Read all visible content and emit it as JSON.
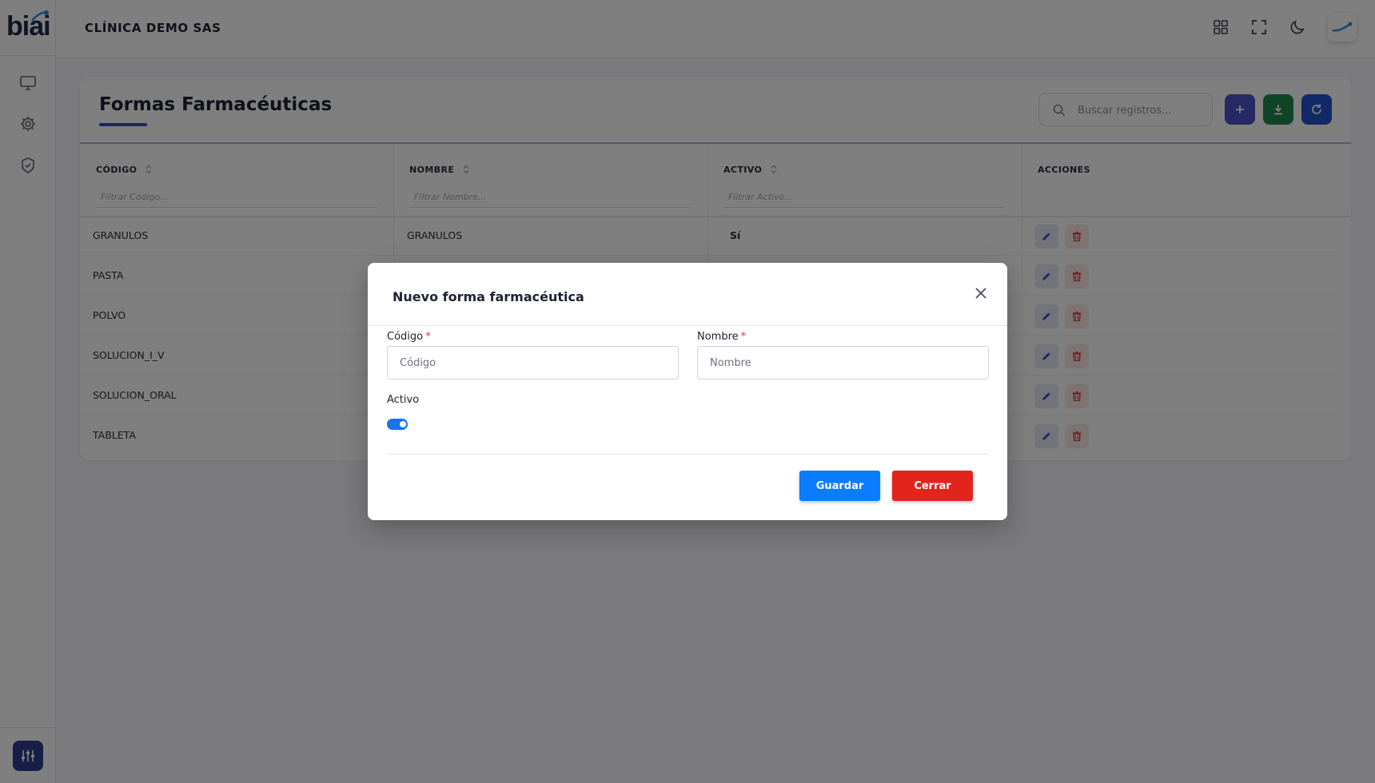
{
  "app": {
    "logo_text": "biai"
  },
  "topbar": {
    "company": "CLÍNICA DEMO SAS",
    "icons": [
      "apps-grid-icon",
      "fullscreen-icon",
      "dark-mode-moon-icon",
      "user-avatar"
    ]
  },
  "sidebar": {
    "icons": [
      "monitor-icon",
      "gear-icon",
      "shield-check-icon"
    ],
    "bottom_button_icon": "sliders-icon"
  },
  "page": {
    "title": "Formas Farmacéuticas",
    "search_placeholder": "Buscar registros...",
    "actions": [
      "add-icon",
      "download-icon",
      "refresh-icon"
    ],
    "colors": {
      "accent": "#3a4bc4",
      "add": "#4a55c9",
      "download": "#1f8a4c",
      "refresh": "#2453d1"
    }
  },
  "table": {
    "columns": [
      {
        "label": "CÓDIGO",
        "filter_placeholder": "Filtrar Código..."
      },
      {
        "label": "NOMBRE",
        "filter_placeholder": "Filtrar Nombre..."
      },
      {
        "label": "ACTIVO",
        "filter_placeholder": "Filtrar Activo..."
      },
      {
        "label": "ACCIONES"
      }
    ],
    "rows": [
      {
        "codigo": "GRANULOS",
        "nombre": "GRANULOS",
        "activo": "Sí"
      },
      {
        "codigo": "PASTA",
        "nombre": "",
        "activo": ""
      },
      {
        "codigo": "POLVO",
        "nombre": "",
        "activo": ""
      },
      {
        "codigo": "SOLUCION_I_V",
        "nombre": "",
        "activo": ""
      },
      {
        "codigo": "SOLUCION_ORAL",
        "nombre": "",
        "activo": ""
      },
      {
        "codigo": "TABLETA",
        "nombre": "",
        "activo": ""
      }
    ]
  },
  "modal": {
    "title": "Nuevo forma farmacéutica",
    "fields": {
      "codigo": {
        "label": "Código",
        "required_mark": "*",
        "placeholder": "Código",
        "value": ""
      },
      "nombre": {
        "label": "Nombre",
        "required_mark": "*",
        "placeholder": "Nombre",
        "value": ""
      },
      "activo": {
        "label": "Activo",
        "checked": true
      }
    },
    "save_label": "Guardar",
    "close_label": "Cerrar",
    "colors": {
      "save": "#0a7cff",
      "close": "#e2241c",
      "toggle": "#1a73e8"
    }
  }
}
